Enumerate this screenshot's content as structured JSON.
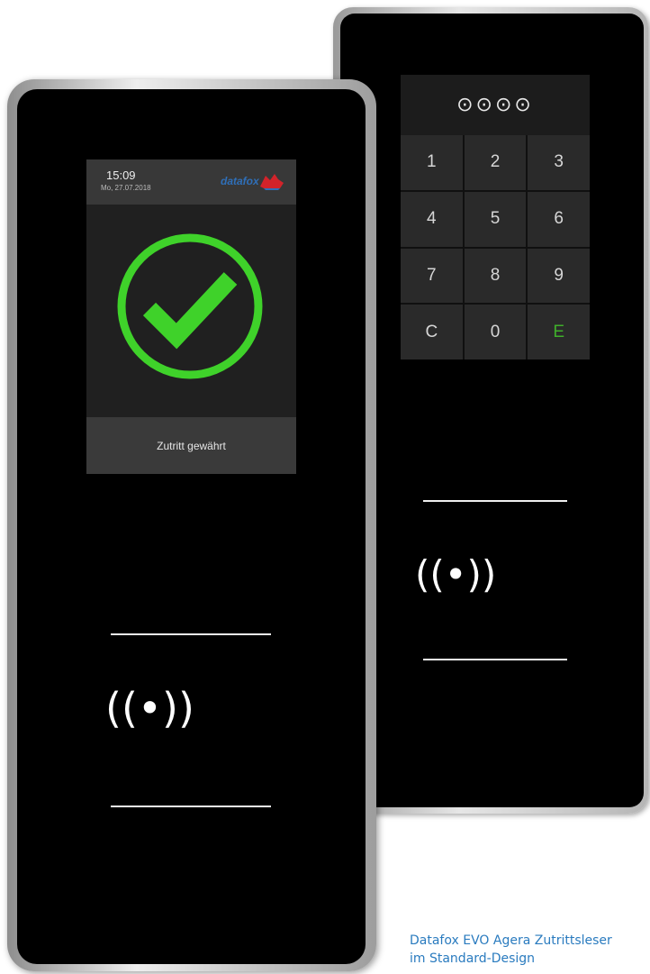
{
  "keypad": {
    "pin_display": "⊙⊙⊙⊙",
    "keys": [
      "1",
      "2",
      "3",
      "4",
      "5",
      "6",
      "7",
      "8",
      "9",
      "C",
      "0",
      "E"
    ]
  },
  "reader_symbol": "((•))",
  "display": {
    "time": "15:09",
    "date": "Mo, 27.07.2018",
    "logo": "datafox",
    "status": "Zutritt gewährt"
  },
  "caption": {
    "line1": "Datafox EVO Agera Zutrittsleser",
    "line2": "im Standard-Design"
  },
  "colors": {
    "accent_green": "#3fd22a",
    "logo_blue": "#2f6fb8",
    "caption_blue": "#2a7bbf"
  }
}
